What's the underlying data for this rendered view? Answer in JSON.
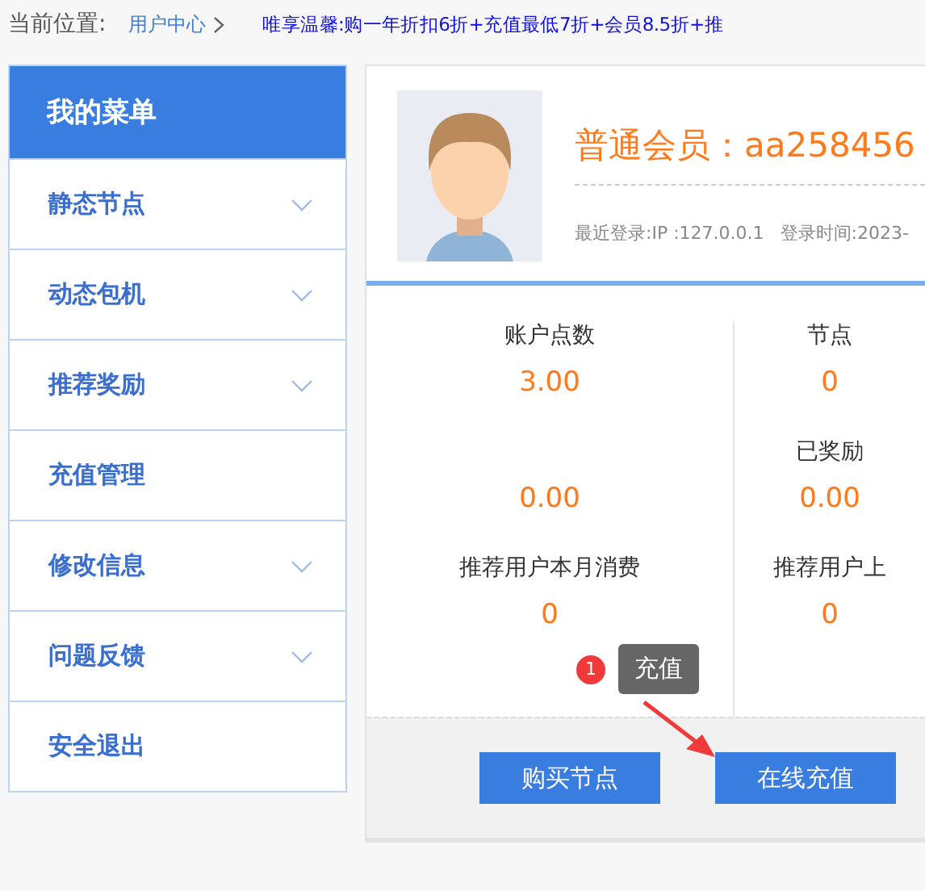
{
  "breadcrumb": {
    "label": "当前位置:",
    "current": "用户中心"
  },
  "notice": "唯享温馨:购一年折扣6折+充值最低7折+会员8.5折+推",
  "sidebar": {
    "title": "我的菜单",
    "items": [
      {
        "label": "静态节点",
        "has_submenu": true
      },
      {
        "label": "动态包机",
        "has_submenu": true
      },
      {
        "label": "推荐奖励",
        "has_submenu": true
      },
      {
        "label": "充值管理",
        "has_submenu": false
      },
      {
        "label": "修改信息",
        "has_submenu": true
      },
      {
        "label": "问题反馈",
        "has_submenu": true
      },
      {
        "label": "安全退出",
        "has_submenu": false
      }
    ]
  },
  "profile": {
    "title": "普通会员：aa258456",
    "last_login": "最近登录:IP :127.0.0.1",
    "login_time": "登录时间:2023-"
  },
  "stats": [
    {
      "items": [
        {
          "label": "账户点数",
          "value": "3.00"
        },
        {
          "value": "0.00"
        },
        {
          "label": "推荐用户本月消费",
          "value": "0"
        }
      ]
    },
    {
      "items": [
        {
          "label": "节点",
          "value": "0"
        },
        {
          "label": "已奖励",
          "value": "0.00"
        },
        {
          "label": "推荐用户上",
          "value": "0"
        }
      ]
    }
  ],
  "tooltip": {
    "badge": "1",
    "text": "充值"
  },
  "buttons": [
    "购买节点",
    "在线充值"
  ]
}
